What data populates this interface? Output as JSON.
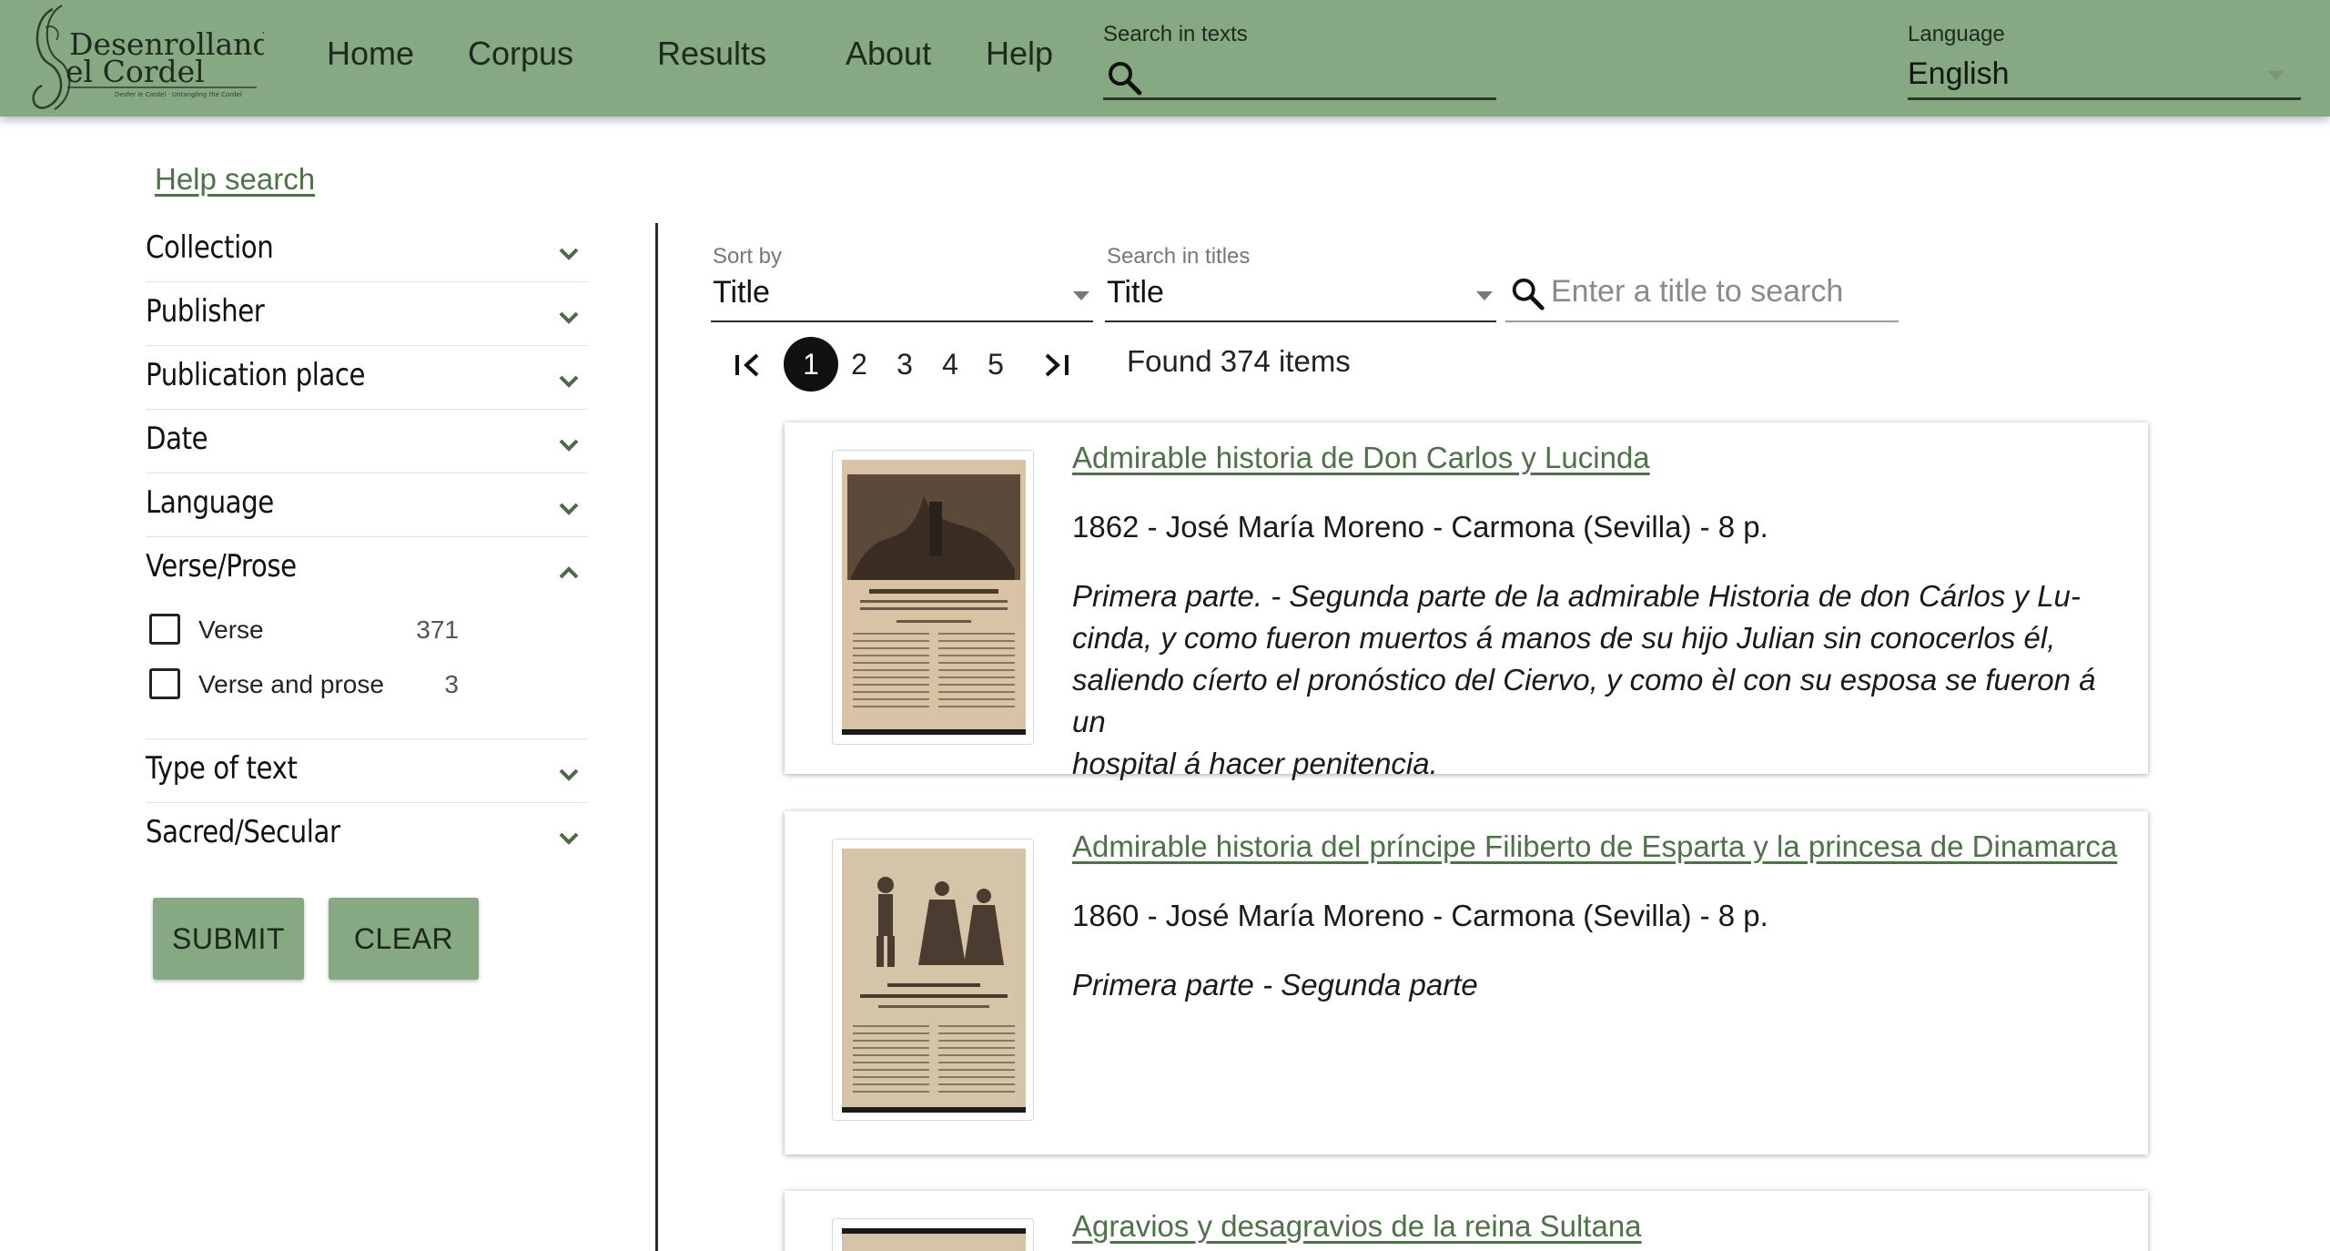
{
  "header": {
    "logo": {
      "line1": "Desenrollando",
      "line2": "el Cordel",
      "tagline": "Desfer le Cordel · Untangling the Cordel"
    },
    "nav": [
      "Home",
      "Corpus",
      "Results",
      "About",
      "Help"
    ],
    "search_texts_label": "Search in texts",
    "language_label": "Language",
    "language_value": "English"
  },
  "sidebar": {
    "help_search": "Help search",
    "facets": [
      {
        "name": "Collection",
        "open": false
      },
      {
        "name": "Publisher",
        "open": false
      },
      {
        "name": "Publication place",
        "open": false
      },
      {
        "name": "Date",
        "open": false
      },
      {
        "name": "Language",
        "open": false
      },
      {
        "name": "Verse/Prose",
        "open": true,
        "options": [
          {
            "label": "Verse",
            "count": "371",
            "checked": false
          },
          {
            "label": "Verse and prose",
            "count": "3",
            "checked": false
          }
        ]
      },
      {
        "name": "Type of text",
        "open": false
      },
      {
        "name": "Sacred/Secular",
        "open": false
      }
    ],
    "submit": "SUBMIT",
    "clear": "CLEAR"
  },
  "results": {
    "sort_by_label": "Sort by",
    "sort_by_value": "Title",
    "search_titles_label": "Search in titles",
    "search_titles_value": "Title",
    "title_search_placeholder": "Enter a title to search",
    "pages": [
      "1",
      "2",
      "3",
      "4",
      "5"
    ],
    "current_page": "1",
    "found": "Found 374 items",
    "items": [
      {
        "title": "Admirable historia de Don Carlos y Lucinda",
        "meta": "1862 - José María Moreno - Carmona (Sevilla) - 8 p.",
        "desc_lines": [
          "Primera parte. - Segunda parte de la admirable Historia de don Cárlos y Lu-",
          "cinda, y como fueron muertos á manos de su hijo Julian sin conocerlos él,",
          "saliendo cíerto el pronóstico del Ciervo, y como èl con su esposa se fueron á un",
          "hospital á hacer penitencia."
        ]
      },
      {
        "title": "Admirable historia del príncipe Filiberto de Esparta y la princesa de Dinamarca",
        "meta": "1860 - José María Moreno - Carmona (Sevilla) - 8 p.",
        "desc_lines": [
          "Primera parte - Segunda parte"
        ]
      },
      {
        "title": "Agravios y desagravios de la reina Sultana",
        "meta": "",
        "desc_lines": []
      }
    ]
  },
  "colors": {
    "header_bg": "#86a882",
    "link": "#4e7248",
    "button_bg": "#86a882"
  }
}
